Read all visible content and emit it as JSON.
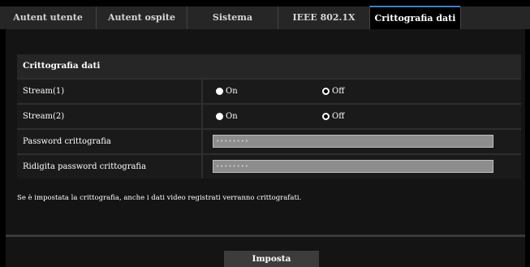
{
  "tabs": [
    {
      "label": "Autent utente"
    },
    {
      "label": "Autent ospite"
    },
    {
      "label": "Sistema"
    },
    {
      "label": "IEEE 802.1X"
    },
    {
      "label": "Crittografia dati",
      "active": true
    }
  ],
  "section": {
    "title": "Crittografia dati"
  },
  "rows": [
    {
      "label": "Stream(1)",
      "options": [
        "On",
        "Off"
      ],
      "selected": "Off"
    },
    {
      "label": "Stream(2)",
      "options": [
        "On",
        "Off"
      ],
      "selected": "Off"
    },
    {
      "label": "Password crittografia",
      "value": "••••••••"
    },
    {
      "label": "Ridigita password crittografia",
      "value": "••••••••"
    }
  ],
  "note": "Se è impostata la crittografia, anche i dati video registrati verranno crittografati.",
  "submit_label": "Imposta",
  "colors": {
    "active_tab_accent": "#3e7fc5",
    "background": "#000000",
    "panel": "#141414"
  }
}
